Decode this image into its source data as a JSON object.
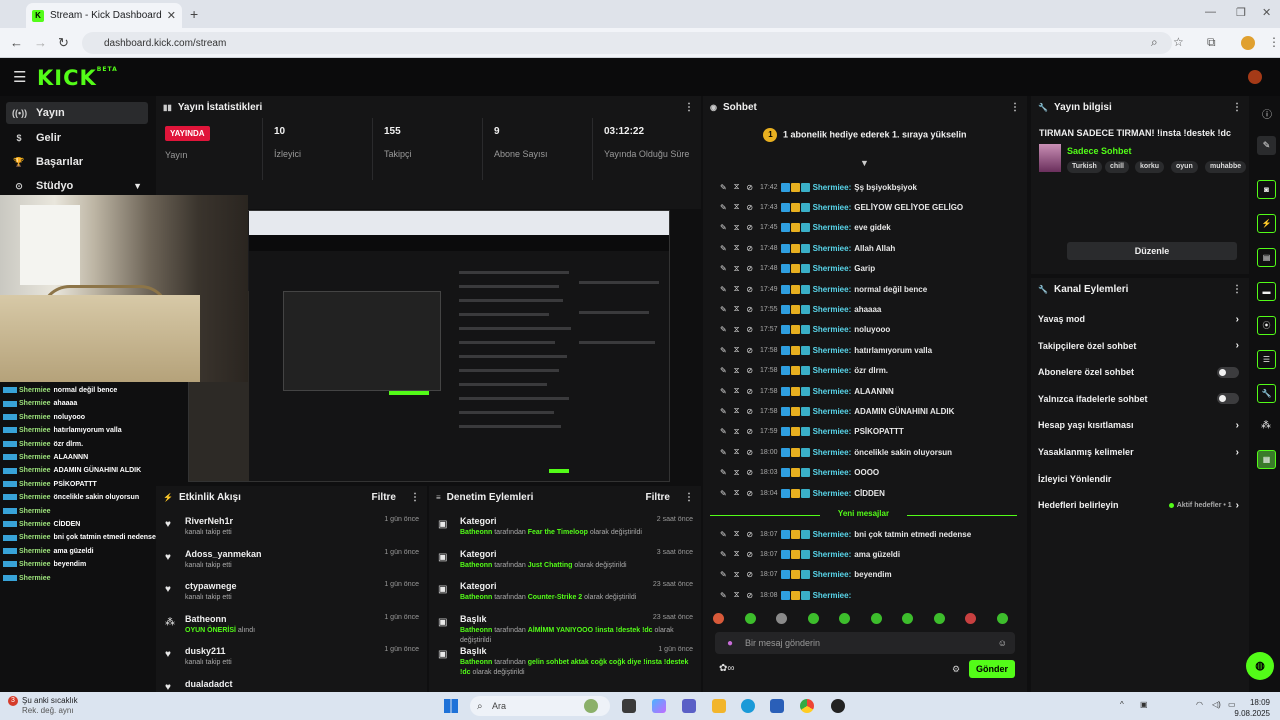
{
  "browser": {
    "tab_title": "Stream - Kick Dashboard",
    "url": "dashboard.kick.com/stream"
  },
  "brand": {
    "logo": "KICK",
    "beta": "BETA",
    "accent": "#53fc18"
  },
  "sidebar": {
    "items": [
      {
        "label": "Yayın",
        "icon": "broadcast-icon"
      },
      {
        "label": "Gelir",
        "icon": "dollar-icon"
      },
      {
        "label": "Başarılar",
        "icon": "trophy-icon"
      },
      {
        "label": "Stüdyo",
        "icon": "studio-icon"
      }
    ]
  },
  "overlay_chat": [
    {
      "user": "Shermiee",
      "msg": "normal değil bence"
    },
    {
      "user": "Shermiee",
      "msg": "ahaaaa"
    },
    {
      "user": "Shermiee",
      "msg": "noluyooo"
    },
    {
      "user": "Shermiee",
      "msg": "hatırlamıyorum valla"
    },
    {
      "user": "Shermiee",
      "msg": "özr dlrm."
    },
    {
      "user": "Shermiee",
      "msg": "ALAANNN"
    },
    {
      "user": "Shermiee",
      "msg": "ADAMIN GÜNAHINI ALDIK"
    },
    {
      "user": "Shermiee",
      "msg": "PSİKOPATTT"
    },
    {
      "user": "Shermiee",
      "msg": "öncelikle sakin oluyorsun"
    },
    {
      "user": "Shermiee",
      "msg": ""
    },
    {
      "user": "Shermiee",
      "msg": "CİDDEN"
    },
    {
      "user": "Shermiee",
      "msg": "bni çok tatmin etmedi nedense"
    },
    {
      "user": "Shermiee",
      "msg": "ama güzeldi"
    },
    {
      "user": "Shermiee",
      "msg": "beyendim"
    },
    {
      "user": "Shermiee",
      "msg": ""
    }
  ],
  "stats": {
    "title": "Yayın İstatistikleri",
    "live_badge": "YAYINDA",
    "live_label": "Yayın",
    "viewers": "10",
    "viewers_label": "İzleyici",
    "followers": "155",
    "followers_label": "Takipçi",
    "subs": "9",
    "subs_label": "Abone Sayısı",
    "uptime": "03:12:22",
    "uptime_label": "Yayında Olduğu Süre"
  },
  "activity": {
    "title": "Etkinlik Akışı",
    "filter": "Filtre",
    "items": [
      {
        "name": "RiverNeh1r",
        "sub": "kanalı takip etti",
        "time": "1 gün önce",
        "icon": "heart-icon"
      },
      {
        "name": "Adoss_yanmekan",
        "sub": "kanalı takip etti",
        "time": "1 gün önce",
        "icon": "heart-icon"
      },
      {
        "name": "ctypawnege",
        "sub": "kanalı takip etti",
        "time": "1 gün önce",
        "icon": "heart-icon"
      },
      {
        "name": "Batheonn",
        "sub_green": "OYUN ÖNERİSİ",
        "sub": "alındı",
        "time": "1 gün önce",
        "icon": "people-icon"
      },
      {
        "name": "dusky211",
        "sub": "kanalı takip etti",
        "time": "1 gün önce",
        "icon": "heart-icon"
      },
      {
        "name": "dualadadct",
        "sub": "",
        "time": "",
        "icon": "heart-icon"
      }
    ]
  },
  "moderation": {
    "title": "Denetim Eylemleri",
    "filter": "Filtre",
    "items": [
      {
        "title": "Kategori",
        "user": "Batheonn",
        "mid": "tarafından",
        "value": "Fear the Timeloop",
        "tail": "olarak değiştirildi",
        "time": "2 saat önce"
      },
      {
        "title": "Kategori",
        "user": "Batheonn",
        "mid": "tarafından",
        "value": "Just Chatting",
        "tail": "olarak değiştirildi",
        "time": "3 saat önce"
      },
      {
        "title": "Kategori",
        "user": "Batheonn",
        "mid": "tarafından",
        "value": "Counter-Strike 2",
        "tail": "olarak değiştirildi",
        "time": "23 saat önce"
      },
      {
        "title": "Başlık",
        "user": "Batheonn",
        "mid": "tarafından",
        "value": "AİMİMM YANIYOOO !insta !destek !dc",
        "tail": "olarak değiştirildi",
        "time": "23 saat önce"
      },
      {
        "title": "Başlık",
        "user": "Batheonn",
        "mid": "tarafından",
        "value": "gelin sohbet aktak coğk coğk diye !insta !destek !dc",
        "tail": "olarak değiştirildi",
        "time": "1 gün önce"
      }
    ]
  },
  "chat": {
    "title": "Sohbet",
    "promo": "1 abonelik hediye ederek 1. sıraya yükselin",
    "promo_badge": "1",
    "messages": [
      {
        "time": "17:42",
        "user": "Shermiee:",
        "msg": "Şş bşiyokbşiyok"
      },
      {
        "time": "17:43",
        "user": "Shermiee:",
        "msg": "GELİYOW GELİYOE GELİGO"
      },
      {
        "time": "17:45",
        "user": "Shermiee:",
        "msg": "eve gidek"
      },
      {
        "time": "17:48",
        "user": "Shermiee:",
        "msg": "Allah Allah"
      },
      {
        "time": "17:48",
        "user": "Shermiee:",
        "msg": "Garip"
      },
      {
        "time": "17:49",
        "user": "Shermiee:",
        "msg": "normal değil bence"
      },
      {
        "time": "17:55",
        "user": "Shermiee:",
        "msg": "ahaaaa"
      },
      {
        "time": "17:57",
        "user": "Shermiee:",
        "msg": "noluyooo"
      },
      {
        "time": "17:58",
        "user": "Shermiee:",
        "msg": "hatırlamıyorum valla"
      },
      {
        "time": "17:58",
        "user": "Shermiee:",
        "msg": "özr dlrm."
      },
      {
        "time": "17:58",
        "user": "Shermiee:",
        "msg": "ALAANNN"
      },
      {
        "time": "17:58",
        "user": "Shermiee:",
        "msg": "ADAMIN GÜNAHINI ALDIK"
      },
      {
        "time": "17:59",
        "user": "Shermiee:",
        "msg": "PSİKOPATTT"
      },
      {
        "time": "18:00",
        "user": "Shermiee:",
        "msg": "öncelikle sakin oluyorsun"
      },
      {
        "time": "18:03",
        "user": "Shermiee:",
        "msg": "OOOO"
      },
      {
        "time": "18:04",
        "user": "Shermiee:",
        "msg": "CİDDEN"
      }
    ],
    "new_label": "Yeni mesajlar",
    "new_messages": [
      {
        "time": "18:07",
        "user": "Shermiee:",
        "msg": "bni çok tatmin etmedi nedense"
      },
      {
        "time": "18:07",
        "user": "Shermiee:",
        "msg": "ama güzeldi"
      },
      {
        "time": "18:07",
        "user": "Shermiee:",
        "msg": "beyendim"
      },
      {
        "time": "18:08",
        "user": "Shermiee:",
        "msg": ""
      }
    ],
    "input_placeholder": "Bir mesaj gönderin",
    "send_label": "Gönder"
  },
  "stream_info": {
    "title": "Yayın bilgisi",
    "stream_title": "TIRMAN SADECE TIRMAN! !insta !destek !dc",
    "category": "Sadece Sohbet",
    "tags": [
      "Turkish",
      "chill",
      "korku",
      "oyun",
      "muhabbe"
    ],
    "edit_label": "Düzenle"
  },
  "channel_actions": {
    "title": "Kanal Eylemleri",
    "items": [
      {
        "label": "Yavaş mod",
        "kind": "chevron"
      },
      {
        "label": "Takipçilere özel sohbet",
        "kind": "chevron"
      },
      {
        "label": "Abonelere özel sohbet",
        "kind": "toggle"
      },
      {
        "label": "Yalnızca ifadelerle sohbet",
        "kind": "toggle"
      },
      {
        "label": "Hesap yaşı kısıtlaması",
        "kind": "chevron"
      },
      {
        "label": "Yasaklanmış kelimeler",
        "kind": "chevron"
      },
      {
        "label": "İzleyici Yönlendir",
        "kind": "none"
      },
      {
        "label": "Hedefleri belirleyin",
        "kind": "goal"
      }
    ],
    "goal_side": "Aktif hedefler • 1"
  },
  "taskbar": {
    "weather_line1": "Şu anki sıcaklık",
    "weather_line2": "Rek. değ. aynı",
    "weather_badge": "3",
    "search": "Ara",
    "time": "18:09",
    "date": "9.08.2025"
  }
}
